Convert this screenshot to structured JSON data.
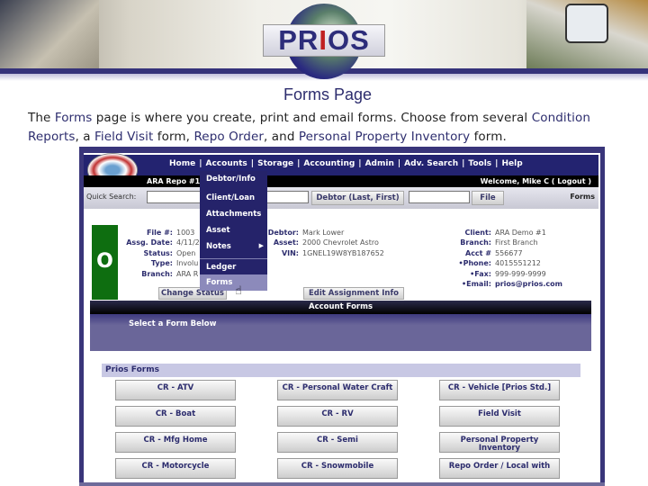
{
  "banner": {
    "logo_text": "PRIOS"
  },
  "page": {
    "title": "Forms Page",
    "intro": [
      {
        "t": "The ",
        "b": false
      },
      {
        "t": "Forms",
        "b": true
      },
      {
        "t": " page is where you create, print and email forms.  Choose from several ",
        "b": false
      },
      {
        "t": "Condition Reports",
        "b": true
      },
      {
        "t": ", a ",
        "b": false
      },
      {
        "t": "Field Visit",
        "b": true
      },
      {
        "t": " form, ",
        "b": false
      },
      {
        "t": "Repo Order",
        "b": true
      },
      {
        "t": ", and ",
        "b": false
      },
      {
        "t": "Personal Property Inventory",
        "b": true
      },
      {
        "t": " form.",
        "b": false
      }
    ]
  },
  "app": {
    "nav": [
      "Home",
      "Accounts",
      "Storage",
      "Accounting",
      "Admin",
      "Adv. Search",
      "Tools",
      "Help"
    ],
    "repo_label": "ARA Repo #1",
    "welcome": "Welcome, Mike C ( Logout )",
    "quick_search_label": "Quick Search:",
    "debtor_button": "Debtor (Last, First)",
    "file_button": "File",
    "section_label": "Forms",
    "status_letter": "O",
    "left_fields": [
      {
        "k": "File #:",
        "v": "1003"
      },
      {
        "k": "Assg. Date:",
        "v": "4/11/2"
      },
      {
        "k": "Status:",
        "v": "Open"
      },
      {
        "k": "Type:",
        "v": "Involu"
      },
      {
        "k": "Branch:",
        "v": "ARA R"
      }
    ],
    "mid_fields": [
      {
        "k": "Debtor:",
        "v": "Mark Lower"
      },
      {
        "k": "Asset:",
        "v": "2000 Chevrolet Astro"
      },
      {
        "k": "VIN:",
        "v": "1GNEL19W8YB187652"
      }
    ],
    "right_fields": [
      {
        "k": "Client:",
        "v": "ARA Demo #1"
      },
      {
        "k": "Branch:",
        "v": "First Branch"
      },
      {
        "k": "Acct #",
        "v": "556677"
      },
      {
        "k": "•Phone:",
        "v": "4015551212"
      },
      {
        "k": "•Fax:",
        "v": "999-999-9999"
      },
      {
        "k": "•Email:",
        "v": "prios@prios.com"
      }
    ],
    "change_status": "Change Status",
    "edit_assignment": "Edit Assignment Info",
    "menu": [
      "Debtor/Info",
      "Client/Loan",
      "Attachments",
      "Asset",
      "Notes",
      "Ledger",
      "Forms"
    ],
    "menu_highlight": "Forms",
    "account_forms": "Account Forms",
    "select_form": "Select a Form Below",
    "prios_forms": "Prios Forms",
    "forms": [
      "CR - ATV",
      "CR - Personal Water Craft",
      "CR - Vehicle [Prios Std.]",
      "CR - Boat",
      "CR - RV",
      "Field Visit",
      "CR - Mfg Home",
      "CR - Semi",
      "Personal Property Inventory",
      "CR - Motorcycle",
      "CR - Snowmobile",
      "Repo Order / Local with"
    ]
  }
}
